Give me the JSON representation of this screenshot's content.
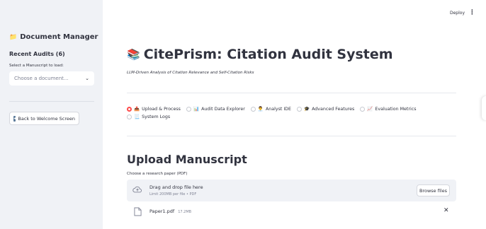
{
  "header": {
    "deploy_label": "Deploy",
    "menu_icon": "⋮"
  },
  "sidebar": {
    "title": "Document Manager",
    "title_icon": "📁",
    "recent_label": "Recent Audits (6)",
    "select_label": "Select a Manuscript to load:",
    "select_placeholder": "Choose a document...",
    "back_label": "Back to Welcome Screen"
  },
  "main": {
    "title": "CitePrism: Citation Audit System",
    "title_icon": "📚",
    "subtitle": "LLM-Driven Analysis of Citation Relevance and Self-Citation Risks",
    "tabs": [
      {
        "label": "Upload & Process",
        "icon": "📤",
        "selected": true
      },
      {
        "label": "Audit Data Explorer",
        "icon": "📊",
        "selected": false
      },
      {
        "label": "Analyst IDE",
        "icon": "👨‍💼",
        "selected": false
      },
      {
        "label": "Advanced Features",
        "icon": "🎓",
        "selected": false
      },
      {
        "label": "Evaluation Metrics",
        "icon": "📈",
        "selected": false
      },
      {
        "label": "System Logs",
        "icon": "📃",
        "selected": false
      }
    ],
    "upload": {
      "title": "Upload Manuscript",
      "label": "Choose a research paper (PDF)",
      "drag_text": "Drag and drop file here",
      "limit_text": "Limit 200MB per file • PDF",
      "browse_label": "Browse files",
      "file_name": "Paper1.pdf",
      "file_size": "17.2MB",
      "close_glyph": "✕"
    }
  },
  "colors": {
    "accent": "#ff4b4b",
    "sidebar_bg": "#f0f2f6",
    "text": "#31333f"
  }
}
